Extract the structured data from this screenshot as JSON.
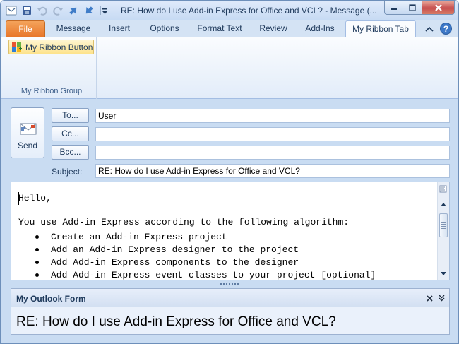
{
  "window": {
    "title": "RE: How do I use Add-in Express for Office and VCL?  -  Message (..."
  },
  "ribbon": {
    "tabs": [
      "File",
      "Message",
      "Insert",
      "Options",
      "Format Text",
      "Review",
      "Add-Ins",
      "My Ribbon Tab"
    ],
    "active_tab": "My Ribbon Tab",
    "button_label": "My Ribbon Button",
    "group_label": "My Ribbon Group"
  },
  "header": {
    "send_label": "Send",
    "to_label": "To...",
    "cc_label": "Cc...",
    "bcc_label": "Bcc...",
    "subject_label": "Subject:",
    "to_value": "User",
    "cc_value": "",
    "bcc_value": "",
    "subject_value": "RE: How do I use Add-in Express for Office and VCL?"
  },
  "body": {
    "greeting": "Hello,",
    "intro": "You use Add-in Express according to the following algorithm:",
    "steps": [
      "Create an Add-in Express project",
      "Add an Add-in Express designer to the project",
      "Add Add-in Express components to the designer",
      "Add Add-in Express event classes to your project [optional]"
    ]
  },
  "form_region": {
    "title": "My Outlook Form",
    "subject": "RE: How do I use Add-in Express for Office and VCL?"
  },
  "icons": {
    "qat": [
      "outlook-logo-icon",
      "save-icon",
      "undo-icon",
      "redo-icon",
      "up-arrow-icon",
      "down-arrow-icon",
      "customize-qat-icon"
    ],
    "window": [
      "minimize-icon",
      "maximize-icon",
      "close-icon"
    ],
    "ribbon": [
      "collapse-ribbon-icon",
      "help-icon",
      "ribbon-button-icon"
    ],
    "form": [
      "close-icon",
      "chevron-down-icon"
    ]
  },
  "colors": {
    "file_tab": "#e8772a",
    "ribbon_button_hover": "#fde38b",
    "close_button": "#c75050"
  }
}
